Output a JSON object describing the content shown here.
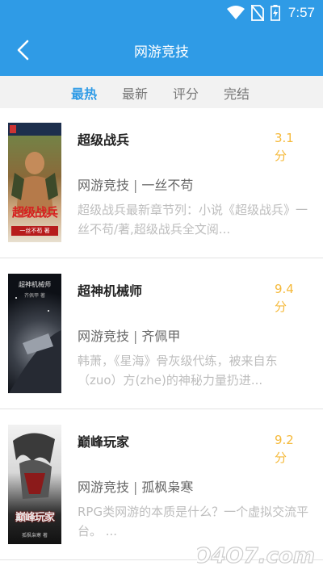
{
  "status_bar": {
    "time": "7:57",
    "icons": [
      "wifi-icon",
      "no-sim-icon",
      "battery-charging-icon"
    ]
  },
  "header": {
    "title": "网游竞技",
    "back_icon": "chevron-left-icon"
  },
  "tabs": [
    {
      "label": "最热",
      "active": true
    },
    {
      "label": "最新",
      "active": false
    },
    {
      "label": "评分",
      "active": false
    },
    {
      "label": "完结",
      "active": false
    }
  ],
  "books": [
    {
      "title": "超级战兵",
      "score": "3.1",
      "score_unit": "分",
      "category": "网游竞技",
      "author": "一丝不苟",
      "description": "超级战兵最新章节列：小说《超级战兵》一丝不苟/著,超级战兵全文阅...",
      "cover_text": "超级战兵",
      "cover_subtext": "一丝不苟 著"
    },
    {
      "title": "超神机械师",
      "score": "9.4",
      "score_unit": "分",
      "category": "网游竞技",
      "author": "齐佩甲",
      "description": "韩萧，《星海》骨灰级代练，被来自东（zuo）方(zhe)的神秘力量扔进...",
      "cover_text": "超神机械师",
      "cover_subtext": "齐佩甲 著"
    },
    {
      "title": "巅峰玩家",
      "score": "9.2",
      "score_unit": "分",
      "category": "网游竞技",
      "author": "孤枫枭寒",
      "description": "RPG类网游的本质是什么？一个虚拟交流平台。 ...",
      "cover_text": "巅峰玩家",
      "cover_subtext": "孤枫枭寒 著"
    }
  ],
  "separator": "|",
  "watermark": "4O4O7.com",
  "colors": {
    "accent": "#2f9be6",
    "score": "#f5b93a",
    "tab_bar_bg": "#f2f2f2"
  }
}
